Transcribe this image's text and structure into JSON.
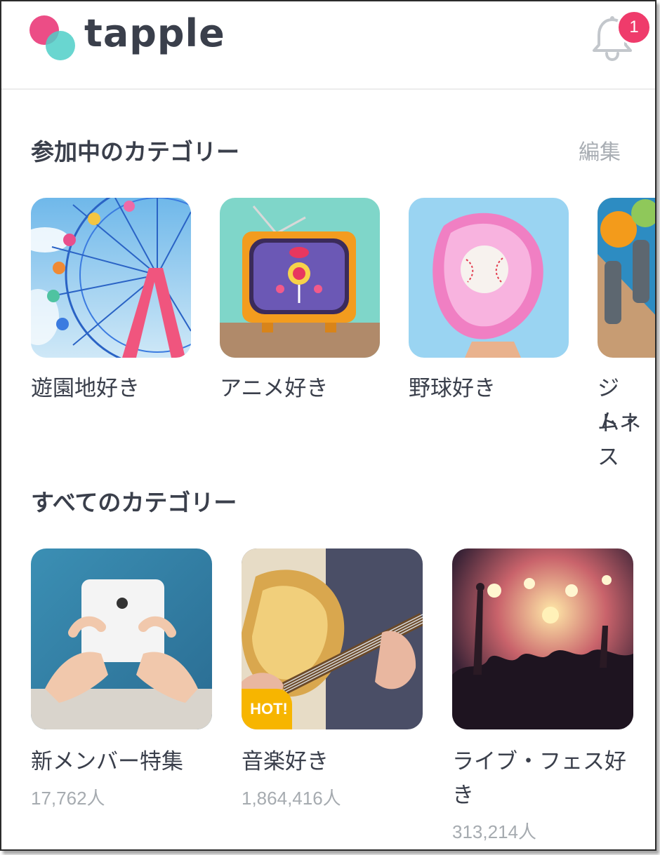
{
  "header": {
    "logo_text": "tapple",
    "notification_count": "1"
  },
  "joined": {
    "title": "参加中のカテゴリー",
    "edit_label": "編集",
    "items": [
      {
        "label": "遊園地好き",
        "icon": "ferris-wheel-image"
      },
      {
        "label": "アニメ好き",
        "icon": "retro-tv-image"
      },
      {
        "label": "野球好き",
        "icon": "baseball-glove-image"
      },
      {
        "label": "ジム・フィットネス",
        "icon": "dumbbell-image",
        "label_line1": "ジム・",
        "label_line2": "トネス"
      }
    ]
  },
  "all": {
    "title": "すべてのカテゴリー",
    "items": [
      {
        "label": "新メンバー特集",
        "count": "17,762人",
        "icon": "smartphone-hands-image"
      },
      {
        "label": "音楽好き",
        "count": "1,864,416人",
        "badge": "HOT!",
        "icon": "guitar-image"
      },
      {
        "label_line1": "ライブ・フェス好",
        "label_line2": "き",
        "count": "313,214人",
        "icon": "concert-crowd-image"
      }
    ]
  },
  "colors": {
    "brand_pink": "#ec4d86",
    "brand_teal": "#4fcfc8",
    "badge_red": "#ef3b6b",
    "hot_yellow": "#f7b500",
    "text_dark": "#3a3f4b",
    "text_muted": "#a6abb0"
  }
}
